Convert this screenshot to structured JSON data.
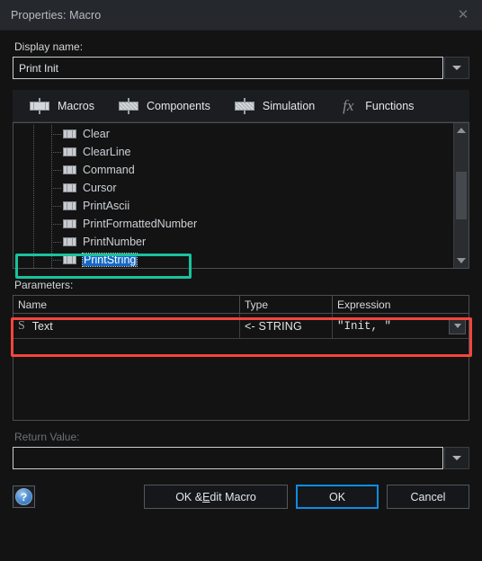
{
  "window": {
    "title": "Properties: Macro",
    "close_icon": "close-icon"
  },
  "display_name": {
    "label": "Display name:",
    "value": "Print Init",
    "placeholder": "",
    "dropdown_icon": "chevron-down-icon"
  },
  "tabs": [
    {
      "label": "Macros",
      "icon": "macro-component-icon",
      "selected": true
    },
    {
      "label": "Components",
      "icon": "resistor-component-icon",
      "selected": false
    },
    {
      "label": "Simulation",
      "icon": "simulation-component-icon",
      "selected": false
    },
    {
      "label": "Functions",
      "icon": "fx-function-icon",
      "selected": false
    }
  ],
  "tab_fx_glyph": "fx",
  "tree": {
    "items": [
      {
        "label": "Clear",
        "selected": false
      },
      {
        "label": "ClearLine",
        "selected": false
      },
      {
        "label": "Command",
        "selected": false
      },
      {
        "label": "Cursor",
        "selected": false
      },
      {
        "label": "PrintAscii",
        "selected": false
      },
      {
        "label": "PrintFormattedNumber",
        "selected": false
      },
      {
        "label": "PrintNumber",
        "selected": false
      },
      {
        "label": "PrintString",
        "selected": true
      }
    ],
    "scroll_up_icon": "scroll-up-arrow-icon",
    "scroll_down_icon": "scroll-down-arrow-icon"
  },
  "parameters": {
    "label": "Parameters:",
    "columns": [
      "Name",
      "Type",
      "Expression"
    ],
    "rows": [
      {
        "type_icon": "S",
        "name": "Text",
        "type": "<- STRING",
        "expression": "\"Init, \"",
        "dropdown_icon": "chevron-down-icon"
      }
    ]
  },
  "return_value": {
    "label": "Return Value:",
    "value": "",
    "placeholder": "",
    "dropdown_icon": "chevron-down-icon"
  },
  "footer": {
    "help_icon": "help-question-icon",
    "help_glyph": "?",
    "buttons": {
      "edit_macro_pre": "OK & ",
      "edit_macro_accel": "E",
      "edit_macro_post": "dit Macro",
      "ok": "OK",
      "cancel": "Cancel"
    }
  },
  "annotations": {
    "selection_highlight_color": "#19c39c",
    "parameter_highlight_color": "#f4453c"
  }
}
